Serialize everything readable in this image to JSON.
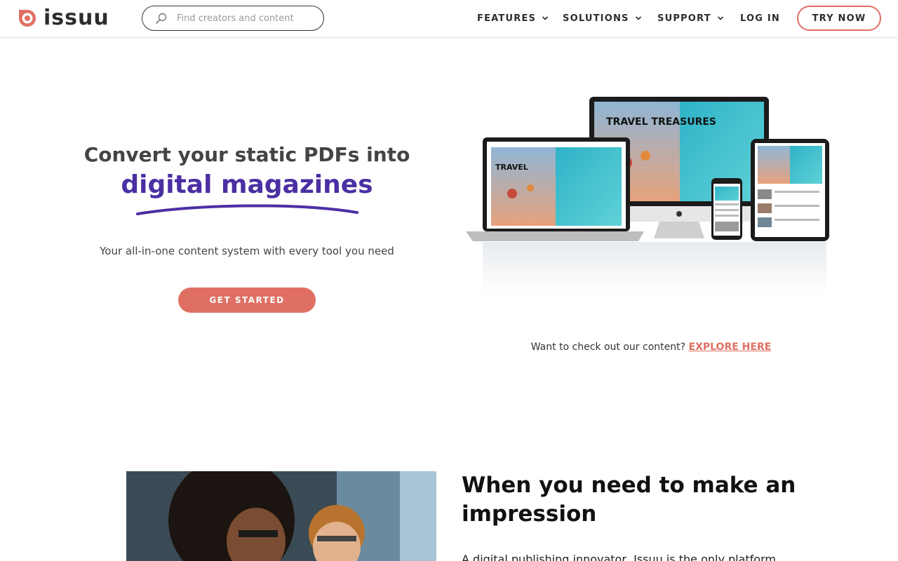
{
  "brand": {
    "name": "issuu",
    "accent": "#e06f63",
    "highlight": "#4b2fa3"
  },
  "search": {
    "placeholder": "Find creators and content",
    "icon": "search-icon"
  },
  "nav": {
    "features": "FEATURES",
    "solutions": "SOLUTIONS",
    "support": "SUPPORT",
    "login": "LOG IN",
    "try_now": "TRY NOW"
  },
  "hero": {
    "title": "Convert your static PDFs into",
    "highlight": "digital magazines",
    "subtitle": "Your all-in-one content system with every tool you need",
    "cta": "GET STARTED",
    "devices_caption": {
      "screen_title": "TRAVEL TREASURES"
    }
  },
  "explore": {
    "prompt": "Want to check out our content?",
    "link": "EXPLORE HERE"
  },
  "impression": {
    "title": "When you need to make an impression",
    "body": "A digital publishing innovator, Issuu is the only platform"
  }
}
